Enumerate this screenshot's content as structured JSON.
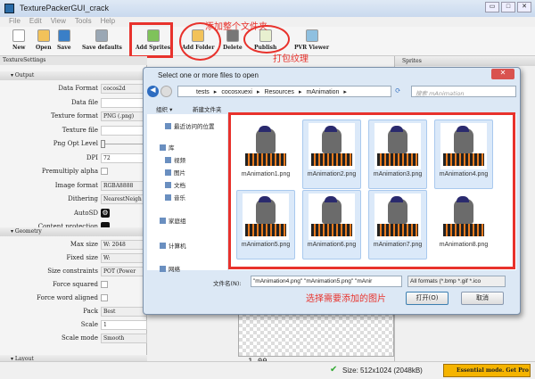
{
  "window": {
    "title": "TexturePackerGUI_crack"
  },
  "menu": [
    "File",
    "Edit",
    "View",
    "Tools",
    "Help"
  ],
  "toolbar": [
    {
      "label": "New",
      "icon": "new-file-icon",
      "color": "#ffffff"
    },
    {
      "label": "Open",
      "icon": "folder-icon",
      "color": "#f2c25a"
    },
    {
      "label": "Save",
      "icon": "save-icon",
      "color": "#3a7fc7"
    },
    {
      "label": "Save defaults",
      "icon": "save-defaults-icon",
      "color": "#9aa7b4"
    },
    {
      "label": "Add Sprites",
      "icon": "add-sprites-icon",
      "color": "#7fc25a"
    },
    {
      "label": "Add Folder",
      "icon": "add-folder-icon",
      "color": "#f2c25a"
    },
    {
      "label": "Delete",
      "icon": "delete-icon",
      "color": "#777777"
    },
    {
      "label": "Publish",
      "icon": "publish-icon",
      "color": "#e8f0d0"
    },
    {
      "label": "PVR Viewer",
      "icon": "pvr-viewer-icon",
      "color": "#8fc0e0"
    }
  ],
  "annotations": {
    "add_folder": "添加整个文件夹",
    "publish": "打包纹理",
    "select_images": "选择需要添加的图片",
    "color": "#e8322c"
  },
  "settings": {
    "panel_title": "TextureSettings",
    "output": {
      "title": "Output",
      "rows": [
        {
          "label": "Data Format",
          "value": "cocos2d",
          "type": "select"
        },
        {
          "label": "Data file",
          "value": "",
          "type": "text"
        },
        {
          "label": "Texture format",
          "value": "PNG (.png)",
          "type": "select"
        },
        {
          "label": "Texture file",
          "value": "",
          "type": "text"
        },
        {
          "label": "Png Opt Level",
          "value": "",
          "type": "slider"
        },
        {
          "label": "DPI",
          "value": "72",
          "type": "text"
        },
        {
          "label": "Premultiply alpha",
          "value": "",
          "type": "checkbox"
        },
        {
          "label": "Image format",
          "value": "RGBA8888",
          "type": "select"
        },
        {
          "label": "Dithering",
          "value": "NearestNeigh",
          "type": "select"
        },
        {
          "label": "AutoSD",
          "value": "",
          "type": "gear"
        },
        {
          "label": "Content protection",
          "value": "",
          "type": "lock"
        }
      ]
    },
    "geometry": {
      "title": "Geometry",
      "rows": [
        {
          "label": "Max size",
          "value": "W: 2048",
          "type": "select"
        },
        {
          "label": "Fixed size",
          "value": "W:",
          "type": "select"
        },
        {
          "label": "Size constraints",
          "value": "POT (Power",
          "type": "select"
        },
        {
          "label": "Force squared",
          "value": "",
          "type": "checkbox"
        },
        {
          "label": "Force word aligned",
          "value": "",
          "type": "checkbox"
        },
        {
          "label": "Pack",
          "value": "Best",
          "type": "select"
        },
        {
          "label": "Scale",
          "value": "1",
          "type": "text"
        },
        {
          "label": "Scale mode",
          "value": "Smooth",
          "type": "select"
        }
      ]
    },
    "layout": {
      "title": "Layout"
    }
  },
  "sprites_panel": {
    "title": "Sprites"
  },
  "dialog": {
    "title": "Select one or more files to open",
    "breadcrumb": [
      "tests",
      "cocosxuexi",
      "Resources",
      "mAnimation"
    ],
    "search_placeholder": "搜索 mAnimation",
    "organize": "组织 ▾",
    "new_folder": "新建文件夹",
    "nav": [
      {
        "label": "最近访问的位置",
        "level": 1
      },
      {
        "label": "库",
        "level": 0
      },
      {
        "label": "视频",
        "level": 1
      },
      {
        "label": "图片",
        "level": 1
      },
      {
        "label": "文档",
        "level": 1
      },
      {
        "label": "音乐",
        "level": 1
      },
      {
        "label": "家庭组",
        "level": 0
      },
      {
        "label": "计算机",
        "level": 0
      },
      {
        "label": "网络",
        "level": 0
      }
    ],
    "files": [
      {
        "name": "mAnimation1.png",
        "selected": false
      },
      {
        "name": "mAnimation2.png",
        "selected": true
      },
      {
        "name": "mAnimation3.png",
        "selected": true
      },
      {
        "name": "mAnimation4.png",
        "selected": true
      },
      {
        "name": "mAnimation5.png",
        "selected": true
      },
      {
        "name": "mAnimation6.png",
        "selected": true
      },
      {
        "name": "mAnimation7.png",
        "selected": true
      },
      {
        "name": "mAnimation8.png",
        "selected": false
      }
    ],
    "filename_label": "文件名(N):",
    "filename_value": "\"mAnimation4.png\" \"mAnimation5.png\" \"mAnir",
    "filter": "All formats (*.bmp *.gif *.ico",
    "open": "打开(O)",
    "cancel": "取消"
  },
  "preview": {
    "zoom": "1.00"
  },
  "status": {
    "size": "Size: 512x1024 (2048kB)",
    "essential": "Essential mode. Get Pro"
  }
}
